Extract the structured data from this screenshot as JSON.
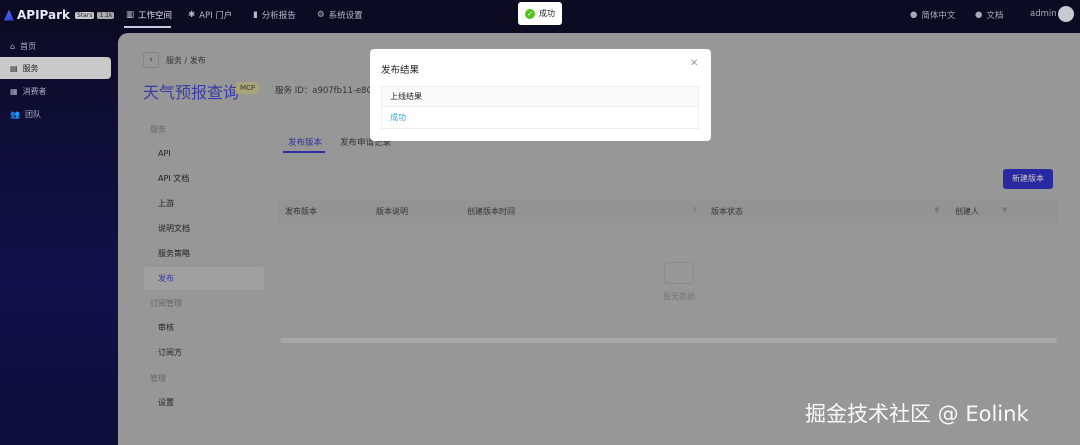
{
  "header": {
    "logo": "APIPark",
    "github_stars_label": "Stars",
    "github_stars_count": "1.1k",
    "nav": [
      {
        "label": "工作空间",
        "icon": "workspace-icon"
      },
      {
        "label": "API 门户",
        "icon": "portal-icon"
      },
      {
        "label": "分析报告",
        "icon": "chart-icon"
      },
      {
        "label": "系统设置",
        "icon": "gear-icon"
      }
    ],
    "language": "简体中文",
    "docs": "文档",
    "user": "admin"
  },
  "sidebar": {
    "items": [
      {
        "label": "首页",
        "icon": "home-icon"
      },
      {
        "label": "服务",
        "icon": "service-icon"
      },
      {
        "label": "消费者",
        "icon": "grid-icon"
      },
      {
        "label": "团队",
        "icon": "team-icon"
      }
    ]
  },
  "main": {
    "breadcrumb": [
      "服务",
      "/",
      "发布"
    ],
    "title": "天气预报查询",
    "badge": "MCP",
    "service_id": "服务 ID：a907fb11-e803-",
    "subnav": {
      "group1": "服务",
      "items1": [
        "API",
        "API 文档",
        "上游",
        "说明文档",
        "服务策略",
        "发布"
      ],
      "group2": "订阅管理",
      "items2": [
        "审核",
        "订阅方"
      ],
      "group3": "管理",
      "items3": [
        "设置"
      ]
    },
    "tabs": [
      "发布版本",
      "发布申请记录"
    ],
    "new_button": "新建版本",
    "columns": [
      "发布版本",
      "版本说明",
      "创建版本时间",
      "版本状态",
      "创建人"
    ],
    "empty": "暂无数据"
  },
  "modal": {
    "title": "发布结果",
    "column": "上线结果",
    "value": "成功"
  },
  "toast": {
    "text": "成功"
  },
  "watermark": "掘金技术社区 @ Eolink",
  "colors": {
    "accent": "#3030a0",
    "success": "#52c41a",
    "link": "#3aa0e0"
  }
}
